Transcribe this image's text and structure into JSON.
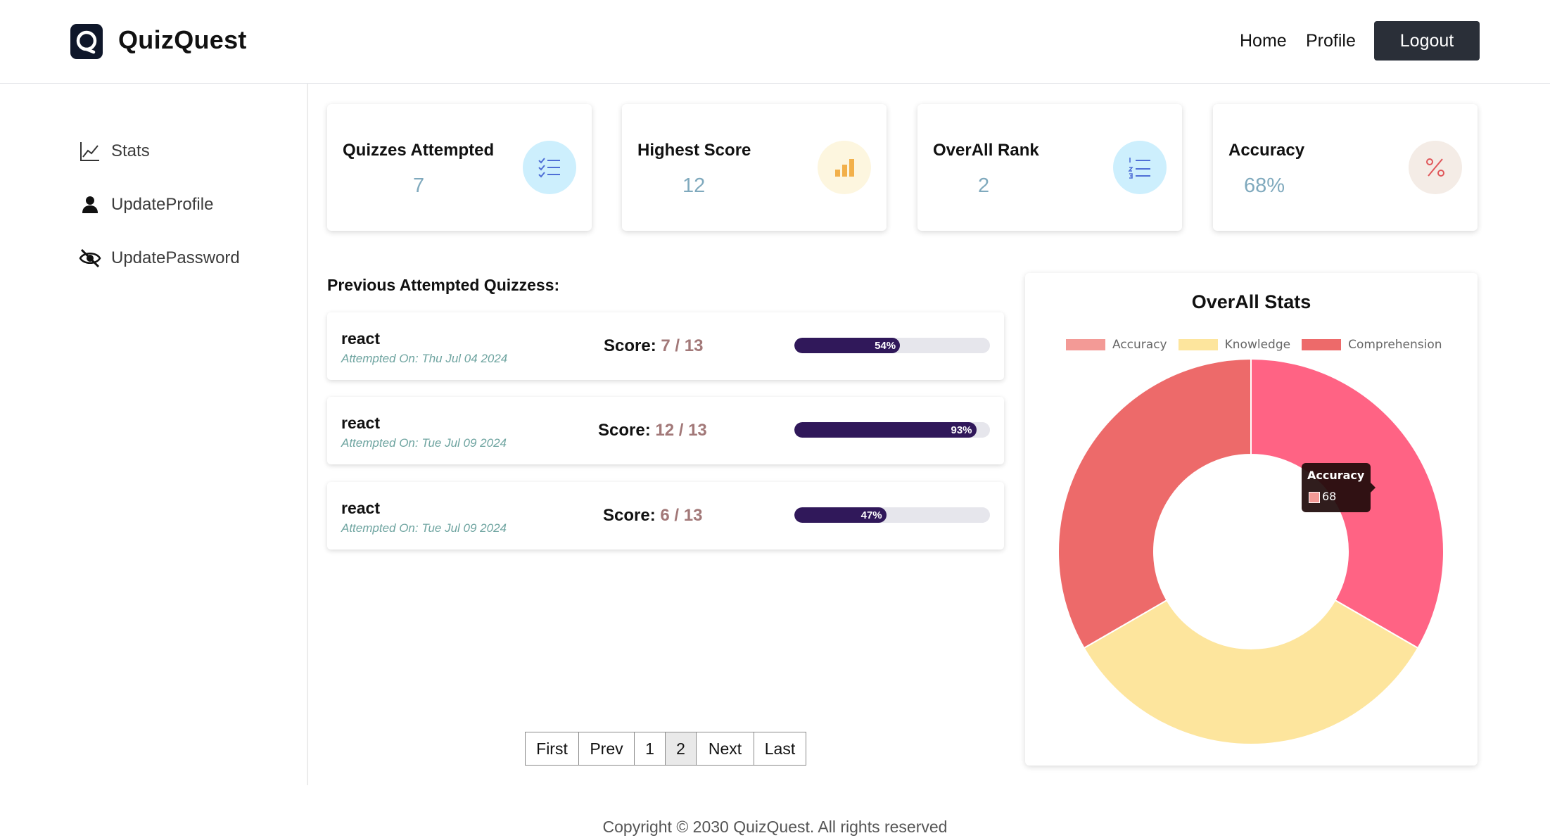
{
  "header": {
    "brand": "QuizQuest",
    "logo_icon": "quiz-logo-icon",
    "nav": {
      "home": "Home",
      "profile": "Profile",
      "logout": "Logout"
    }
  },
  "sidebar": {
    "items": [
      {
        "label": "Stats",
        "icon": "line-chart-icon"
      },
      {
        "label": "UpdateProfile",
        "icon": "user-icon"
      },
      {
        "label": "UpdatePassword",
        "icon": "eye-slash-icon"
      }
    ]
  },
  "stats": [
    {
      "title": "Quizzes Attempted",
      "value": "7",
      "icon": "checklist-icon",
      "icon_bg": "#cdeffd",
      "icon_color": "#4f6fd6"
    },
    {
      "title": "Highest Score",
      "value": "12",
      "icon": "bar-chart-icon",
      "icon_bg": "#fdf6df",
      "icon_color": "#f2b04a"
    },
    {
      "title": "OverAll Rank",
      "value": "2",
      "icon": "numbered-list-icon",
      "icon_bg": "#cdeffd",
      "icon_color": "#4f6fd6"
    },
    {
      "title": "Accuracy",
      "value": "68%",
      "icon": "percent-icon",
      "icon_bg": "#f4ece6",
      "icon_color": "#e0575a"
    }
  ],
  "previous": {
    "title": "Previous Attempted Quizzess:",
    "score_label": "Score:",
    "quizzes": [
      {
        "name": "react",
        "date": "Attempted On: Thu Jul 04 2024",
        "score": "7 / 13",
        "percent": 54,
        "percent_label": "54%"
      },
      {
        "name": "react",
        "date": "Attempted On: Tue Jul 09 2024",
        "score": "12 / 13",
        "percent": 93,
        "percent_label": "93%"
      },
      {
        "name": "react",
        "date": "Attempted On: Tue Jul 09 2024",
        "score": "6 / 13",
        "percent": 47,
        "percent_label": "47%"
      }
    ]
  },
  "pagination": {
    "buttons": [
      "First",
      "Prev",
      "1",
      "2",
      "Next",
      "Last"
    ],
    "current": "2"
  },
  "chart": {
    "title": "OverAll Stats",
    "tooltip": {
      "title": "Accuracy",
      "value": "68"
    }
  },
  "chart_data": {
    "type": "doughnut",
    "title": "OverAll Stats",
    "categories": [
      "Accuracy",
      "Knowledge",
      "Comprehension"
    ],
    "values": [
      68,
      68,
      68
    ],
    "colors": [
      "#ff6384",
      "#fde59d",
      "#ed6a6a"
    ],
    "legend_colors": [
      "#f39a96",
      "#fde59d",
      "#ed6a6a"
    ],
    "legend_position": "top"
  },
  "footer": {
    "text": "Copyright © 2030 QuizQuest. All rights reserved"
  }
}
